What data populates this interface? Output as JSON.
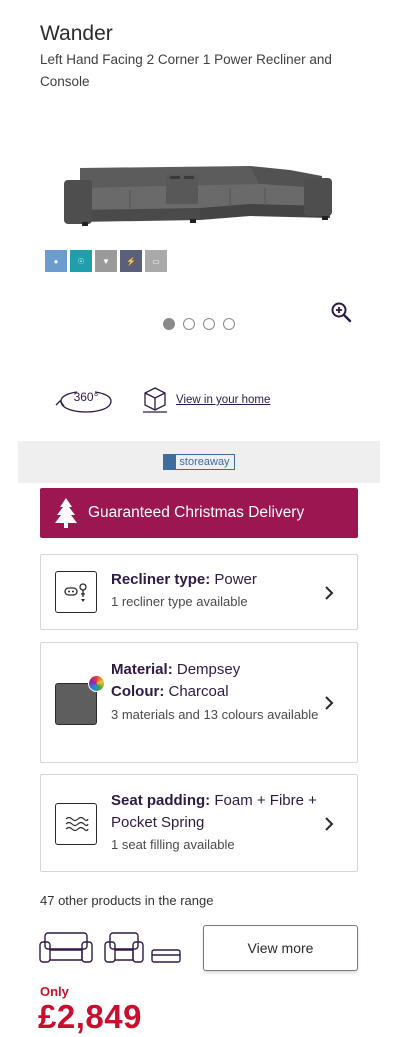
{
  "product": {
    "title": "Wander",
    "subtitle": "Left Hand Facing 2 Corner 1 Power Recliner and Console"
  },
  "gallery": {
    "swatches": [
      {
        "icon": "person-icon",
        "color": "#6a9ccf"
      },
      {
        "icon": "light-icon",
        "color": "#1f9eab"
      },
      {
        "icon": "recline-icon",
        "color": "#9a9a9a"
      },
      {
        "icon": "charge-icon",
        "color": "#5a5f7a"
      },
      {
        "icon": "storage-icon",
        "color": "#a9a9a9"
      }
    ],
    "dots": [
      true,
      false,
      false,
      false
    ]
  },
  "views": {
    "view360_label": "360°",
    "view_home_label": "View in your home"
  },
  "storeaway": {
    "logo_text": "storeaway"
  },
  "christmas": {
    "label": "Guaranteed Christmas Delivery"
  },
  "options": {
    "recliner": {
      "label": "Recliner type:",
      "value": "Power",
      "sub": "1 recliner type available"
    },
    "material": {
      "label": "Material:",
      "value": "Dempsey",
      "colour_label": "Colour:",
      "colour_value": "Charcoal",
      "sub": "3 materials and 13 colours available",
      "swatch_color": "#5e5e5e"
    },
    "padding": {
      "label": "Seat padding:",
      "value": "Foam + Fibre + Pocket Spring",
      "sub": "1 seat filling available"
    }
  },
  "range": {
    "text": "47 other products in the range",
    "button_label": "View more"
  },
  "price": {
    "prefix": "Only",
    "amount": "£2,849"
  },
  "colors": {
    "accent": "#9c1652",
    "price": "#c8102e",
    "text_dark": "#2e1a44"
  }
}
